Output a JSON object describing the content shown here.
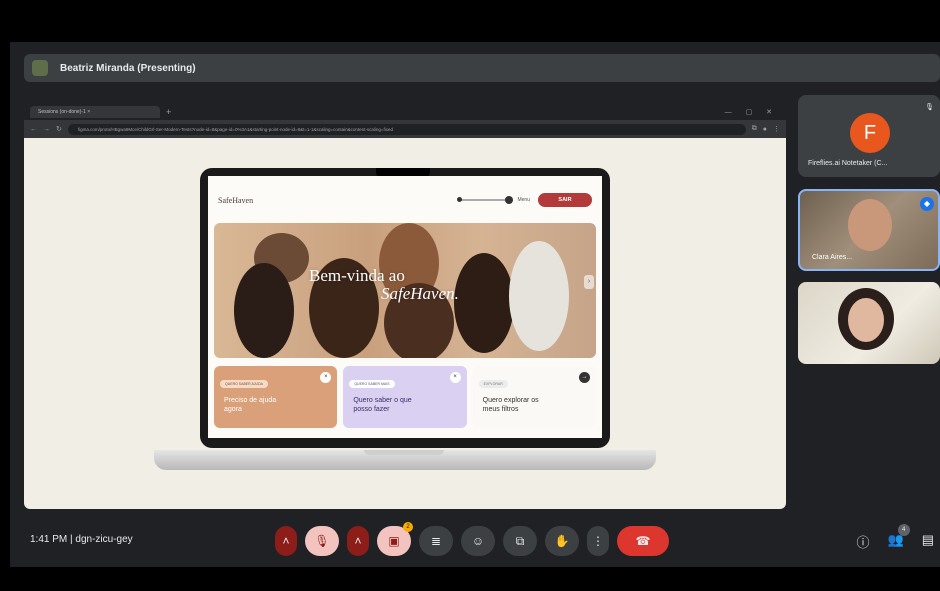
{
  "presenter": {
    "label": "Beatriz Miranda (Presenting)"
  },
  "browser": {
    "tab_title": "Sessions (on-done)-1 ×",
    "url": "figma.com/proto/HBgwa9Mce/ChildGrl-Ser-Modern-Tests?node-id=8&page-id=0%3A1&starting-point-node-id=8&t=1-1&scaling=contain&content-scaling=fixed"
  },
  "site": {
    "logo": "SafeHaven",
    "menu_label": "Menu",
    "exit_label": "SAIR",
    "hero_title_line1": "Bem-vinda ao",
    "hero_title_line2": "SafeHaven.",
    "cards": [
      {
        "chip": "QUERO SABER AJUDA",
        "title": "Preciso de ajuda agora",
        "close": "×"
      },
      {
        "chip": "QUERO SABER MAIS",
        "title": "Quero saber o que posso fazer",
        "close": "×"
      },
      {
        "chip": "EXPLORAR",
        "title": "Quero explorar os meus filtros",
        "close": "→"
      }
    ]
  },
  "participants": [
    {
      "initial": "F",
      "name": "Fireflies.ai Notetaker (C...",
      "mic": "🎙"
    },
    {
      "name": "Clara Aires...",
      "badge": "◆"
    },
    {
      "name": ""
    }
  ],
  "meeting": {
    "time_code": "1:41 PM  |  dgn-zicu-gey",
    "reaction_count": "2",
    "people_count": "4",
    "icons": {
      "more_mic": "˄",
      "mic": "🎙",
      "more_cam": "˄",
      "cam": "▣",
      "captions": "≣",
      "emoji": "☺",
      "present": "⧉",
      "hand": "✋",
      "more": "⋮",
      "end": "☎",
      "info": "ⓘ",
      "people": "👥",
      "chat": "▤"
    }
  }
}
